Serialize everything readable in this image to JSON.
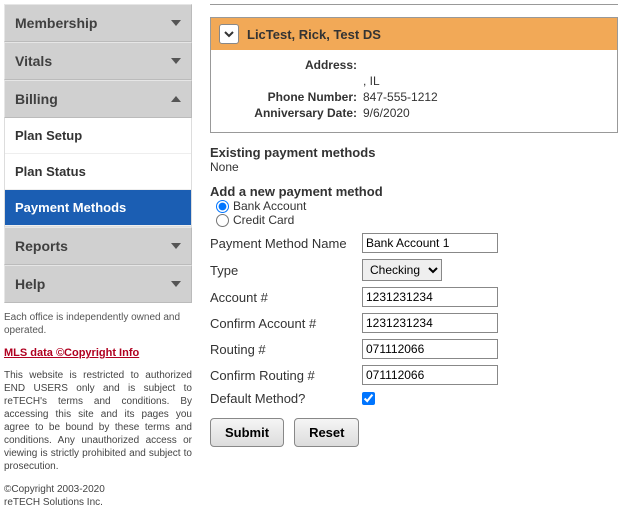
{
  "sidebar": {
    "sections": {
      "membership": "Membership",
      "vitals": "Vitals",
      "billing": "Billing",
      "reports": "Reports",
      "help": "Help"
    },
    "billing_items": {
      "plan_setup": "Plan Setup",
      "plan_status": "Plan Status",
      "payment_methods": "Payment Methods"
    },
    "office_note": "Each office is independently owned and operated.",
    "mls_link": "MLS data ©Copyright Info",
    "legal": "This website is restricted to authorized END USERS only and is subject to reTECH's terms and conditions. By accessing this site and its pages you agree to be bound by these terms and conditions. Any unauthorized access or viewing is strictly prohibited and subject to prosecution.",
    "copyright_line1": "©Copyright 2003-2020",
    "copyright_line2": "reTECH Solutions Inc."
  },
  "member": {
    "title": "LicTest, Rick, Test DS",
    "address_label": "Address:",
    "address_value": ", IL",
    "phone_label": "Phone Number:",
    "phone_value": "847-555-1212",
    "anniv_label": "Anniversary Date:",
    "anniv_value": "9/6/2020"
  },
  "existing": {
    "heading": "Existing payment methods",
    "value": "None"
  },
  "add": {
    "heading": "Add a new payment method",
    "opt_bank": "Bank Account",
    "opt_card": "Credit Card",
    "name_label": "Payment Method Name",
    "name_value": "Bank Account 1",
    "type_label": "Type",
    "type_value": "Checking",
    "account_label": "Account #",
    "account_value": "1231231234",
    "confirm_account_label": "Confirm Account #",
    "confirm_account_value": "1231231234",
    "routing_label": "Routing #",
    "routing_value": "071112066",
    "confirm_routing_label": "Confirm Routing #",
    "confirm_routing_value": "071112066",
    "default_label": "Default Method?",
    "default_checked": true,
    "submit": "Submit",
    "reset": "Reset"
  }
}
